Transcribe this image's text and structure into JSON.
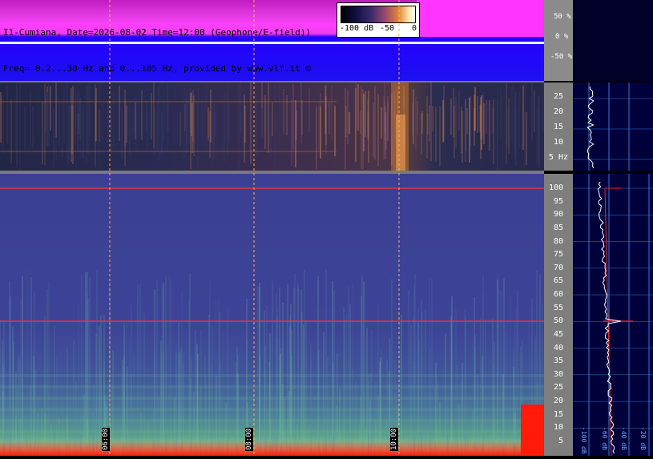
{
  "header": {
    "line1": "I1-Cumiana, Date=2026-08-02 Time=12:00 (Geophone/E-field))",
    "line2": "Freq= 0.2...30 Hz and 0...105 Hz, provided by www.vlf.it ©"
  },
  "scale": {
    "min": "-100 dB",
    "mid": "-50",
    "max": "0"
  },
  "pct_axis": [
    "50 %",
    "0 %",
    "-50 %"
  ],
  "low_axis": [
    "25",
    "20",
    "15",
    "10",
    "5 Hz"
  ],
  "high_axis": [
    "100",
    "95",
    "90",
    "85",
    "80",
    "75",
    "70",
    "65",
    "60",
    "55",
    "50",
    "45",
    "40",
    "35",
    "30",
    "25",
    "20",
    "15",
    "10",
    "5"
  ],
  "time_marks": [
    "06:00",
    "08:00",
    "10:00"
  ],
  "profile_labels": [
    "-100 dB",
    "-60 dB",
    "-40 dB",
    "-20 dB"
  ],
  "colors": {
    "waveform_bg": "#ff40ff",
    "waveform_low": "#2500ff",
    "mains_line": "#ff2020",
    "grid": "#5aa0ff"
  }
}
